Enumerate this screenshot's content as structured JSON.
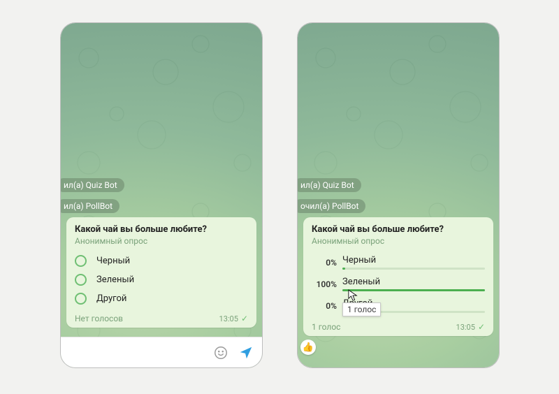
{
  "left": {
    "pills": [
      "ил(а) Quiz Bot",
      "ил(а) PollBot"
    ],
    "poll": {
      "question": "Какой чай вы больше любите?",
      "subtitle": "Анонимный опрос",
      "options": [
        "Черный",
        "Зеленый",
        "Другой"
      ],
      "footer": "Нет голосов",
      "time": "13:05"
    }
  },
  "right": {
    "pills": [
      "ил(а) Quiz Bot",
      "очил(а) PollBot"
    ],
    "poll": {
      "question": "Какой чай вы больше любите?",
      "subtitle": "Анонимный опрос",
      "results": [
        {
          "pct": "0%",
          "label": "Черный",
          "fill": 0
        },
        {
          "pct": "100%",
          "label": "Зеленый",
          "fill": 100
        },
        {
          "pct": "0%",
          "label": "Другой",
          "fill": 0
        }
      ],
      "footer": "1 голос",
      "time": "13:05",
      "tooltip": "1 голос"
    }
  }
}
